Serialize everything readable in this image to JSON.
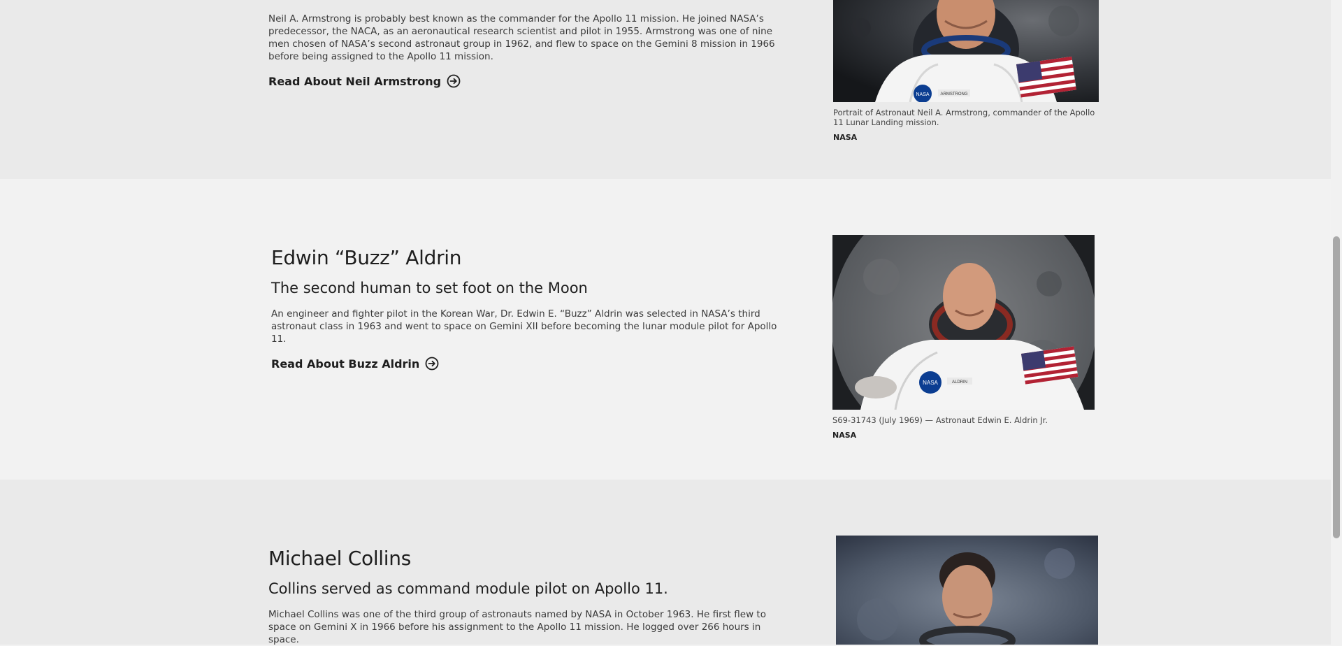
{
  "armstrong": {
    "bio": "Neil A. Armstrong is probably best known as the commander for the Apollo 11 mission. He joined NASA’s predecessor, the NACA, as an aeronautical research scientist and pilot in 1955. Armstrong was one of nine men chosen of NASA’s second astronaut group in 1962, and flew to space on the Gemini 8 mission in 1966 before being assigned to the Apollo 11 mission.",
    "link_label": "Read About Neil Armstrong",
    "image_caption": "Portrait of Astronaut Neil A. Armstrong, commander of the Apollo 11 Lunar Landing mission.",
    "image_credit": "NASA",
    "badge_text": "ARMSTRONG"
  },
  "aldrin": {
    "name": "Edwin “Buzz” Aldrin",
    "subtitle": "The second human to set foot on the Moon",
    "bio": "An engineer and fighter pilot in the Korean War, Dr. Edwin E. “Buzz” Aldrin was selected in NASA’s third astronaut class in 1963 and went to space on Gemini XII before becoming the lunar module pilot for Apollo 11.",
    "link_label": "Read About Buzz Aldrin",
    "image_caption": "S69-31743 (July 1969) — Astronaut Edwin E. Aldrin Jr.",
    "image_credit": "NASA",
    "badge_text": "ALDRIN"
  },
  "collins": {
    "name": "Michael Collins",
    "subtitle": "Collins served as command module pilot on Apollo 11.",
    "bio": "Michael Collins was one of the third group of astronauts named by NASA in October 1963. He first flew to space on Gemini X in 1966 before his assignment to the Apollo 11 mission. He logged over 266 hours in space."
  },
  "colors": {
    "section_gray": "#eaeaea",
    "section_light": "#f2f2f2",
    "text": "#1e1e1e",
    "suit": "#f4f4f4",
    "nasa_blue": "#0b3d91"
  }
}
